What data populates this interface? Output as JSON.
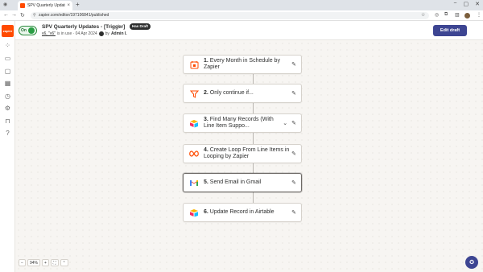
{
  "browser": {
    "tab_title": "SPV Quarterly Updates - [",
    "url": "zapier.com/editor/197106841/published",
    "new_tab_label": "+",
    "tab_close": "×"
  },
  "rail": {
    "logo_text": "zapier",
    "icons": [
      "apps-icon",
      "zaps-icon",
      "chat-icon",
      "calendar-icon",
      "history-icon",
      "settings-icon",
      "lock-icon",
      "help-icon"
    ]
  },
  "header": {
    "toggle_label": "On",
    "zap_title": "SPV Quarterly Updates - [Trigger]",
    "status_badge": "Has Draft",
    "version_link": "v6, \"v6\"",
    "in_use_text": "is in use · 04 Apr 2024",
    "by_text": "by",
    "author": "Admin I.",
    "edit_draft_label": "Edit draft"
  },
  "steps": [
    {
      "number": "1.",
      "title": "Every Month in Schedule by Zapier",
      "icon": "schedule-icon",
      "has_chevron": false
    },
    {
      "number": "2.",
      "title": "Only continue if...",
      "icon": "filter-icon",
      "has_chevron": false
    },
    {
      "number": "3.",
      "title": "Find Many Records (With Line Item Suppo...",
      "icon": "airtable-icon",
      "has_chevron": true
    },
    {
      "number": "4.",
      "title": "Create Loop From Line Items in Looping by Zapier",
      "icon": "looping-icon",
      "has_chevron": false
    },
    {
      "number": "5.",
      "title": "Send Email in Gmail",
      "icon": "gmail-icon",
      "has_chevron": false
    },
    {
      "number": "6.",
      "title": "Update Record in Airtable",
      "icon": "airtable-icon",
      "has_chevron": false
    }
  ],
  "zoom": {
    "minus": "−",
    "level": "94%",
    "plus": "+",
    "fit": "⛶",
    "collapse": "⌃"
  },
  "colors": {
    "brand": "#ff4a00",
    "primary_button": "#3d4592",
    "toggle_on": "#2a9d44"
  }
}
